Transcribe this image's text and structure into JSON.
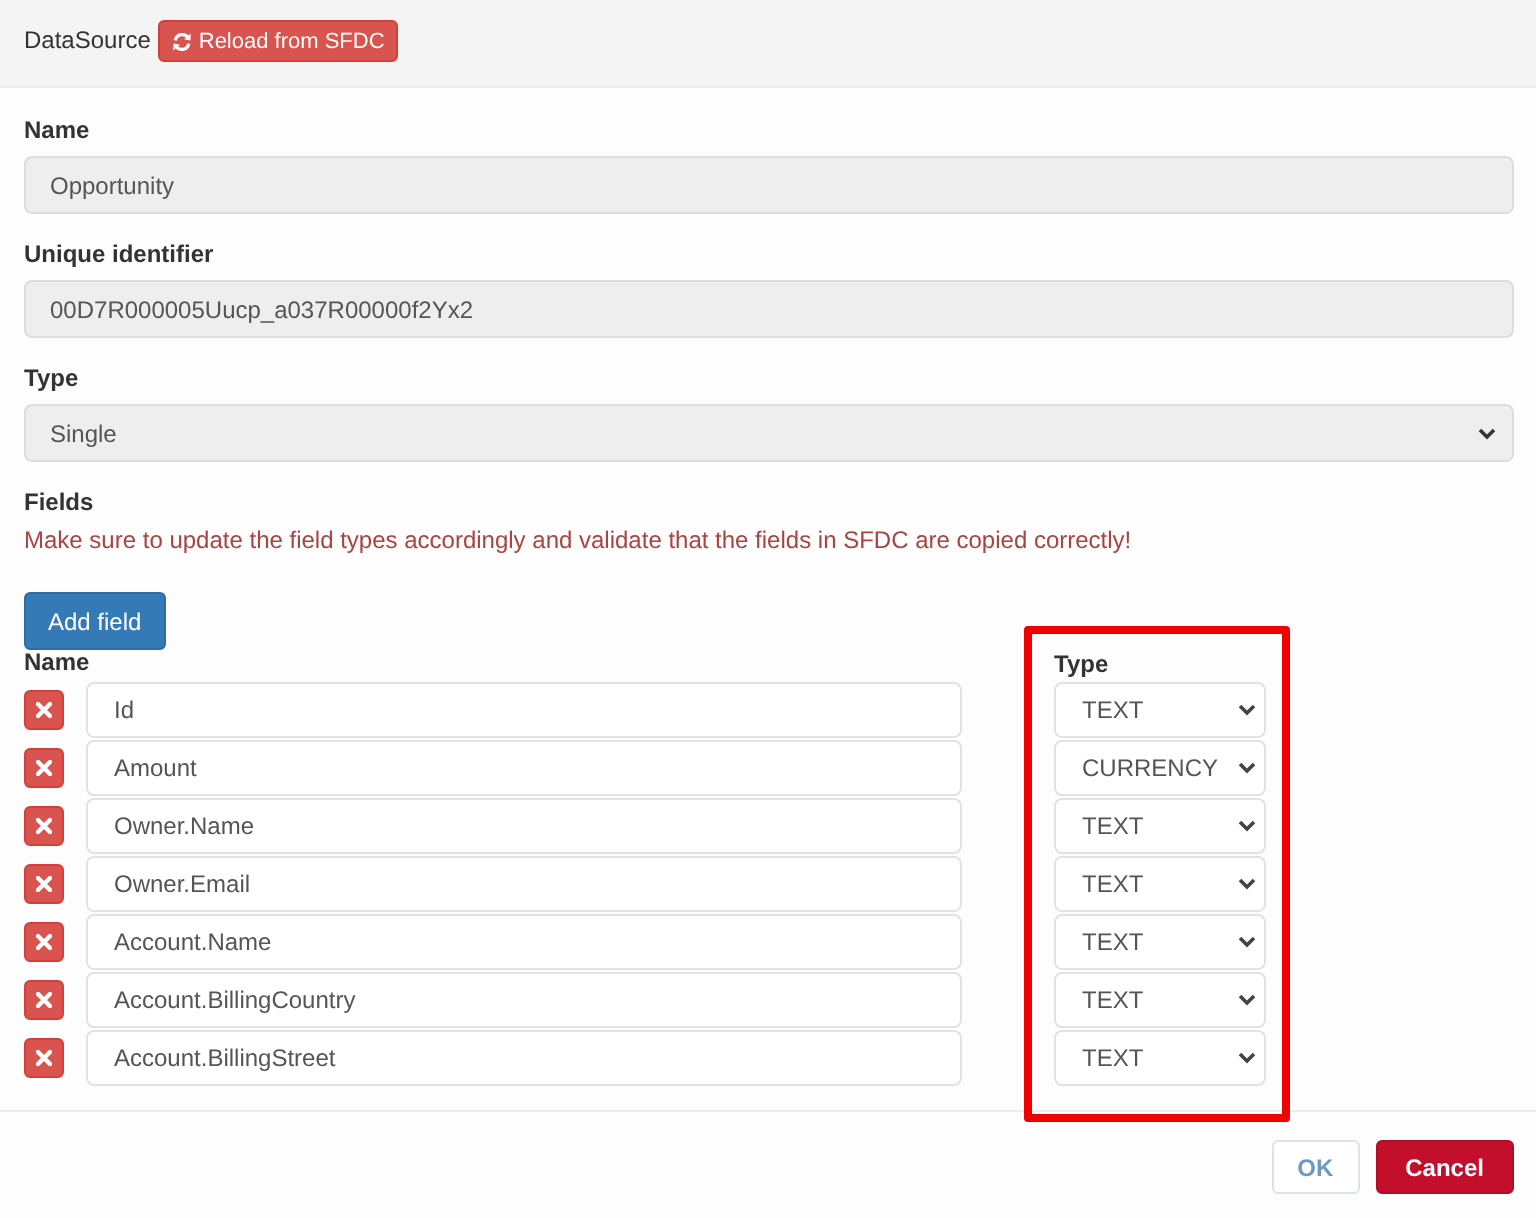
{
  "header": {
    "label": "DataSource",
    "reload_button": "Reload from SFDC"
  },
  "form": [
    {
      "kind": "input",
      "label": "Name",
      "value": "Opportunity",
      "disabled": true
    },
    {
      "kind": "input",
      "label": "Unique identifier",
      "value": "00D7R000005Uucp_a037R00000f2Yx2",
      "disabled": true
    },
    {
      "kind": "select",
      "label": "Type",
      "value": "Single",
      "disabled": true
    }
  ],
  "fields_section": {
    "label": "Fields",
    "warning": "Make sure to update the field types accordingly and validate that the fields in SFDC are copied correctly!",
    "add_button": "Add field",
    "name_column": "Name",
    "type_column": "Type",
    "type_column_highlighted": true,
    "rows": [
      {
        "name": "Id",
        "type": "TEXT"
      },
      {
        "name": "Amount",
        "type": "CURRENCY"
      },
      {
        "name": "Owner.Name",
        "type": "TEXT"
      },
      {
        "name": "Owner.Email",
        "type": "TEXT"
      },
      {
        "name": "Account.Name",
        "type": "TEXT"
      },
      {
        "name": "Account.BillingCountry",
        "type": "TEXT"
      },
      {
        "name": "Account.BillingStreet",
        "type": "TEXT"
      }
    ]
  },
  "footer": {
    "buttons": [
      {
        "kind": "secondary",
        "label": "OK"
      },
      {
        "kind": "danger",
        "label": "Cancel"
      }
    ]
  }
}
